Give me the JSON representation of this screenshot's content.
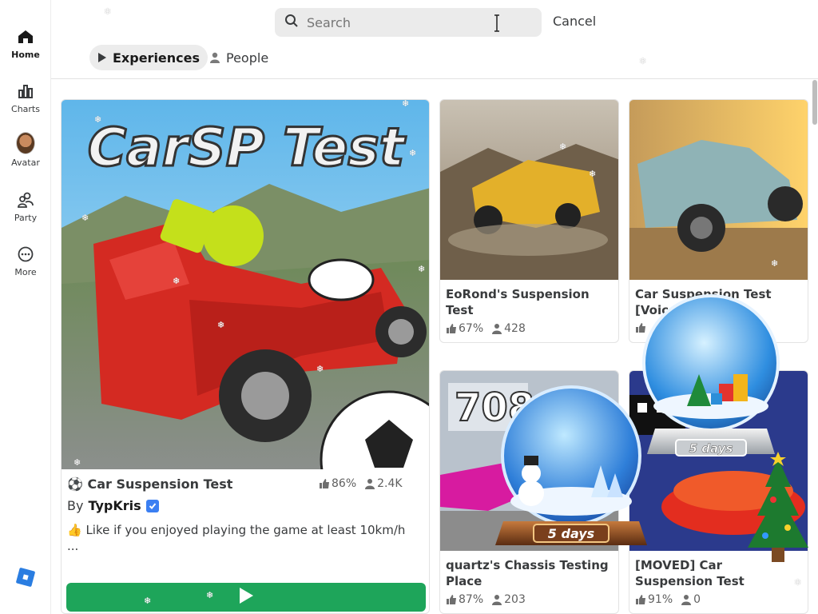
{
  "sidebar": {
    "items": [
      {
        "label": "Home",
        "icon": "home-icon"
      },
      {
        "label": "Charts",
        "icon": "charts-icon"
      },
      {
        "label": "Avatar",
        "icon": "avatar-icon"
      },
      {
        "label": "Party",
        "icon": "party-icon"
      },
      {
        "label": "More",
        "icon": "more-icon"
      }
    ],
    "logo": "roblox-logo-icon"
  },
  "search": {
    "placeholder": "Search",
    "value": ""
  },
  "cancel_label": "Cancel",
  "tabs": [
    {
      "label": "Experiences",
      "icon": "play-icon",
      "active": true
    },
    {
      "label": "People",
      "icon": "person-icon",
      "active": false
    }
  ],
  "featured": {
    "thumb_text": "CarSP Test",
    "title": "Car Suspension Test",
    "like": "86%",
    "players": "2.4K",
    "by": "By",
    "creator": "TypKris",
    "description": "👍 Like if you enjoyed playing the game at least 10km/h",
    "description_more": "..."
  },
  "cards": [
    {
      "title": "EoRond's Suspension Test",
      "like": "67%",
      "players": "428"
    },
    {
      "title": "Car Suspension Test [Voic",
      "like": "",
      "players": ""
    },
    {
      "title": "quartz's Chassis Testing Place",
      "like": "87%",
      "players": "203"
    },
    {
      "title": "[MOVED] Car Suspension Test",
      "like": "91%",
      "players": "0"
    }
  ],
  "overlays": {
    "snowglobe_left_label": "5 days",
    "snowglobe_right_label": "5 days"
  },
  "colors": {
    "play_button": "#1ea55a",
    "verified": "#3b7ff2",
    "active_tab_bg": "#ececec"
  }
}
